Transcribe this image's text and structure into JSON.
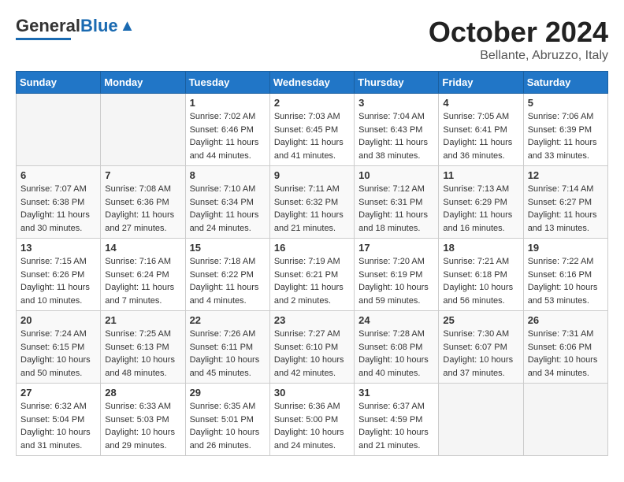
{
  "header": {
    "logo_general": "General",
    "logo_blue": "Blue",
    "month_title": "October 2024",
    "location": "Bellante, Abruzzo, Italy"
  },
  "days_of_week": [
    "Sunday",
    "Monday",
    "Tuesday",
    "Wednesday",
    "Thursday",
    "Friday",
    "Saturday"
  ],
  "weeks": [
    [
      {
        "day": "",
        "sunrise": "",
        "sunset": "",
        "daylight": ""
      },
      {
        "day": "",
        "sunrise": "",
        "sunset": "",
        "daylight": ""
      },
      {
        "day": "1",
        "sunrise": "Sunrise: 7:02 AM",
        "sunset": "Sunset: 6:46 PM",
        "daylight": "Daylight: 11 hours and 44 minutes."
      },
      {
        "day": "2",
        "sunrise": "Sunrise: 7:03 AM",
        "sunset": "Sunset: 6:45 PM",
        "daylight": "Daylight: 11 hours and 41 minutes."
      },
      {
        "day": "3",
        "sunrise": "Sunrise: 7:04 AM",
        "sunset": "Sunset: 6:43 PM",
        "daylight": "Daylight: 11 hours and 38 minutes."
      },
      {
        "day": "4",
        "sunrise": "Sunrise: 7:05 AM",
        "sunset": "Sunset: 6:41 PM",
        "daylight": "Daylight: 11 hours and 36 minutes."
      },
      {
        "day": "5",
        "sunrise": "Sunrise: 7:06 AM",
        "sunset": "Sunset: 6:39 PM",
        "daylight": "Daylight: 11 hours and 33 minutes."
      }
    ],
    [
      {
        "day": "6",
        "sunrise": "Sunrise: 7:07 AM",
        "sunset": "Sunset: 6:38 PM",
        "daylight": "Daylight: 11 hours and 30 minutes."
      },
      {
        "day": "7",
        "sunrise": "Sunrise: 7:08 AM",
        "sunset": "Sunset: 6:36 PM",
        "daylight": "Daylight: 11 hours and 27 minutes."
      },
      {
        "day": "8",
        "sunrise": "Sunrise: 7:10 AM",
        "sunset": "Sunset: 6:34 PM",
        "daylight": "Daylight: 11 hours and 24 minutes."
      },
      {
        "day": "9",
        "sunrise": "Sunrise: 7:11 AM",
        "sunset": "Sunset: 6:32 PM",
        "daylight": "Daylight: 11 hours and 21 minutes."
      },
      {
        "day": "10",
        "sunrise": "Sunrise: 7:12 AM",
        "sunset": "Sunset: 6:31 PM",
        "daylight": "Daylight: 11 hours and 18 minutes."
      },
      {
        "day": "11",
        "sunrise": "Sunrise: 7:13 AM",
        "sunset": "Sunset: 6:29 PM",
        "daylight": "Daylight: 11 hours and 16 minutes."
      },
      {
        "day": "12",
        "sunrise": "Sunrise: 7:14 AM",
        "sunset": "Sunset: 6:27 PM",
        "daylight": "Daylight: 11 hours and 13 minutes."
      }
    ],
    [
      {
        "day": "13",
        "sunrise": "Sunrise: 7:15 AM",
        "sunset": "Sunset: 6:26 PM",
        "daylight": "Daylight: 11 hours and 10 minutes."
      },
      {
        "day": "14",
        "sunrise": "Sunrise: 7:16 AM",
        "sunset": "Sunset: 6:24 PM",
        "daylight": "Daylight: 11 hours and 7 minutes."
      },
      {
        "day": "15",
        "sunrise": "Sunrise: 7:18 AM",
        "sunset": "Sunset: 6:22 PM",
        "daylight": "Daylight: 11 hours and 4 minutes."
      },
      {
        "day": "16",
        "sunrise": "Sunrise: 7:19 AM",
        "sunset": "Sunset: 6:21 PM",
        "daylight": "Daylight: 11 hours and 2 minutes."
      },
      {
        "day": "17",
        "sunrise": "Sunrise: 7:20 AM",
        "sunset": "Sunset: 6:19 PM",
        "daylight": "Daylight: 10 hours and 59 minutes."
      },
      {
        "day": "18",
        "sunrise": "Sunrise: 7:21 AM",
        "sunset": "Sunset: 6:18 PM",
        "daylight": "Daylight: 10 hours and 56 minutes."
      },
      {
        "day": "19",
        "sunrise": "Sunrise: 7:22 AM",
        "sunset": "Sunset: 6:16 PM",
        "daylight": "Daylight: 10 hours and 53 minutes."
      }
    ],
    [
      {
        "day": "20",
        "sunrise": "Sunrise: 7:24 AM",
        "sunset": "Sunset: 6:15 PM",
        "daylight": "Daylight: 10 hours and 50 minutes."
      },
      {
        "day": "21",
        "sunrise": "Sunrise: 7:25 AM",
        "sunset": "Sunset: 6:13 PM",
        "daylight": "Daylight: 10 hours and 48 minutes."
      },
      {
        "day": "22",
        "sunrise": "Sunrise: 7:26 AM",
        "sunset": "Sunset: 6:11 PM",
        "daylight": "Daylight: 10 hours and 45 minutes."
      },
      {
        "day": "23",
        "sunrise": "Sunrise: 7:27 AM",
        "sunset": "Sunset: 6:10 PM",
        "daylight": "Daylight: 10 hours and 42 minutes."
      },
      {
        "day": "24",
        "sunrise": "Sunrise: 7:28 AM",
        "sunset": "Sunset: 6:08 PM",
        "daylight": "Daylight: 10 hours and 40 minutes."
      },
      {
        "day": "25",
        "sunrise": "Sunrise: 7:30 AM",
        "sunset": "Sunset: 6:07 PM",
        "daylight": "Daylight: 10 hours and 37 minutes."
      },
      {
        "day": "26",
        "sunrise": "Sunrise: 7:31 AM",
        "sunset": "Sunset: 6:06 PM",
        "daylight": "Daylight: 10 hours and 34 minutes."
      }
    ],
    [
      {
        "day": "27",
        "sunrise": "Sunrise: 6:32 AM",
        "sunset": "Sunset: 5:04 PM",
        "daylight": "Daylight: 10 hours and 31 minutes."
      },
      {
        "day": "28",
        "sunrise": "Sunrise: 6:33 AM",
        "sunset": "Sunset: 5:03 PM",
        "daylight": "Daylight: 10 hours and 29 minutes."
      },
      {
        "day": "29",
        "sunrise": "Sunrise: 6:35 AM",
        "sunset": "Sunset: 5:01 PM",
        "daylight": "Daylight: 10 hours and 26 minutes."
      },
      {
        "day": "30",
        "sunrise": "Sunrise: 6:36 AM",
        "sunset": "Sunset: 5:00 PM",
        "daylight": "Daylight: 10 hours and 24 minutes."
      },
      {
        "day": "31",
        "sunrise": "Sunrise: 6:37 AM",
        "sunset": "Sunset: 4:59 PM",
        "daylight": "Daylight: 10 hours and 21 minutes."
      },
      {
        "day": "",
        "sunrise": "",
        "sunset": "",
        "daylight": ""
      },
      {
        "day": "",
        "sunrise": "",
        "sunset": "",
        "daylight": ""
      }
    ]
  ]
}
